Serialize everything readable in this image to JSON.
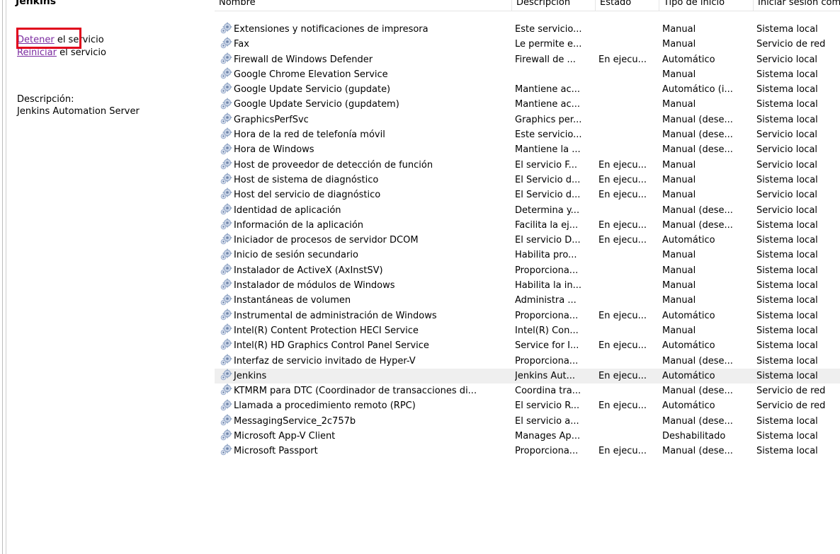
{
  "pane": {
    "title": "Jenkins",
    "stop_link": "Detener",
    "stop_suffix": " el servicio",
    "restart_link": "Reiniciar",
    "restart_suffix": " el servicio",
    "description_label": "Descripción:",
    "description_text": "Jenkins Automation Server"
  },
  "columns": {
    "name": "Nombre",
    "description": "Descripción",
    "state": "Estado",
    "start_type": "Tipo de inicio",
    "logon": "Iniciar sesión como"
  },
  "icon": "gear-service-icon",
  "colors": {
    "highlight_box": "#e0001b",
    "link": "#1a3fb6",
    "visited_link": "#7b2ba0",
    "selected_row": "#efefef"
  },
  "rows": [
    {
      "name": "Extensiones y notificaciones de impresora",
      "description": "Este servicio...",
      "state": "",
      "start": "Manual",
      "logon": "Sistema local"
    },
    {
      "name": "Fax",
      "description": "Le permite e...",
      "state": "",
      "start": "Manual",
      "logon": "Servicio de red"
    },
    {
      "name": "Firewall de Windows Defender",
      "description": "Firewall de ...",
      "state": "En ejecu...",
      "start": "Automático",
      "logon": "Servicio local"
    },
    {
      "name": "Google Chrome Elevation Service",
      "description": "",
      "state": "",
      "start": "Manual",
      "logon": "Sistema local"
    },
    {
      "name": "Google Update Servicio (gupdate)",
      "description": "Mantiene ac...",
      "state": "",
      "start": "Automático (i...",
      "logon": "Sistema local"
    },
    {
      "name": "Google Update Servicio (gupdatem)",
      "description": "Mantiene ac...",
      "state": "",
      "start": "Manual",
      "logon": "Sistema local"
    },
    {
      "name": "GraphicsPerfSvc",
      "description": "Graphics per...",
      "state": "",
      "start": "Manual (dese...",
      "logon": "Sistema local"
    },
    {
      "name": "Hora de la red de telefonía móvil",
      "description": "Este servicio...",
      "state": "",
      "start": "Manual (dese...",
      "logon": "Servicio local"
    },
    {
      "name": "Hora de Windows",
      "description": "Mantiene la ...",
      "state": "",
      "start": "Manual (dese...",
      "logon": "Servicio local"
    },
    {
      "name": "Host de proveedor de detección de función",
      "description": "El servicio F...",
      "state": "En ejecu...",
      "start": "Manual",
      "logon": "Servicio local"
    },
    {
      "name": "Host de sistema de diagnóstico",
      "description": "El Servicio d...",
      "state": "En ejecu...",
      "start": "Manual",
      "logon": "Sistema local"
    },
    {
      "name": "Host del servicio de diagnóstico",
      "description": "El Servicio d...",
      "state": "En ejecu...",
      "start": "Manual",
      "logon": "Servicio local"
    },
    {
      "name": "Identidad de aplicación",
      "description": "Determina y...",
      "state": "",
      "start": "Manual (dese...",
      "logon": "Servicio local"
    },
    {
      "name": "Información de la aplicación",
      "description": "Facilita la ej...",
      "state": "En ejecu...",
      "start": "Manual (dese...",
      "logon": "Sistema local"
    },
    {
      "name": "Iniciador de procesos de servidor DCOM",
      "description": "El servicio D...",
      "state": "En ejecu...",
      "start": "Automático",
      "logon": "Sistema local"
    },
    {
      "name": "Inicio de sesión secundario",
      "description": "Habilita pro...",
      "state": "",
      "start": "Manual",
      "logon": "Sistema local"
    },
    {
      "name": "Instalador de ActiveX (AxInstSV)",
      "description": "Proporciona...",
      "state": "",
      "start": "Manual",
      "logon": "Sistema local"
    },
    {
      "name": "Instalador de módulos de Windows",
      "description": "Habilita la in...",
      "state": "",
      "start": "Manual",
      "logon": "Sistema local"
    },
    {
      "name": "Instantáneas de volumen",
      "description": "Administra ...",
      "state": "",
      "start": "Manual",
      "logon": "Sistema local"
    },
    {
      "name": "Instrumental de administración de Windows",
      "description": "Proporciona...",
      "state": "En ejecu...",
      "start": "Automático",
      "logon": "Sistema local"
    },
    {
      "name": "Intel(R) Content Protection HECI Service",
      "description": "Intel(R) Con...",
      "state": "",
      "start": "Manual",
      "logon": "Sistema local"
    },
    {
      "name": "Intel(R) HD Graphics Control Panel Service",
      "description": "Service for I...",
      "state": "En ejecu...",
      "start": "Automático",
      "logon": "Sistema local"
    },
    {
      "name": "Interfaz de servicio invitado de Hyper-V",
      "description": "Proporciona...",
      "state": "",
      "start": "Manual (dese...",
      "logon": "Sistema local"
    },
    {
      "name": "Jenkins",
      "description": "Jenkins Aut...",
      "state": "En ejecu...",
      "start": "Automático",
      "logon": "Sistema local",
      "selected": true
    },
    {
      "name": "KTMRM para DTC (Coordinador de transacciones di...",
      "description": "Coordina tra...",
      "state": "",
      "start": "Manual (dese...",
      "logon": "Servicio de red"
    },
    {
      "name": "Llamada a procedimiento remoto (RPC)",
      "description": "El servicio R...",
      "state": "En ejecu...",
      "start": "Automático",
      "logon": "Servicio de red"
    },
    {
      "name": "MessagingService_2c757b",
      "description": "El servicio a...",
      "state": "",
      "start": "Manual (dese...",
      "logon": "Sistema local"
    },
    {
      "name": "Microsoft App-V Client",
      "description": "Manages Ap...",
      "state": "",
      "start": "Deshabilitado",
      "logon": "Sistema local"
    },
    {
      "name": "Microsoft Passport",
      "description": "Proporciona...",
      "state": "En ejecu...",
      "start": "Manual (dese...",
      "logon": "Sistema local"
    }
  ]
}
